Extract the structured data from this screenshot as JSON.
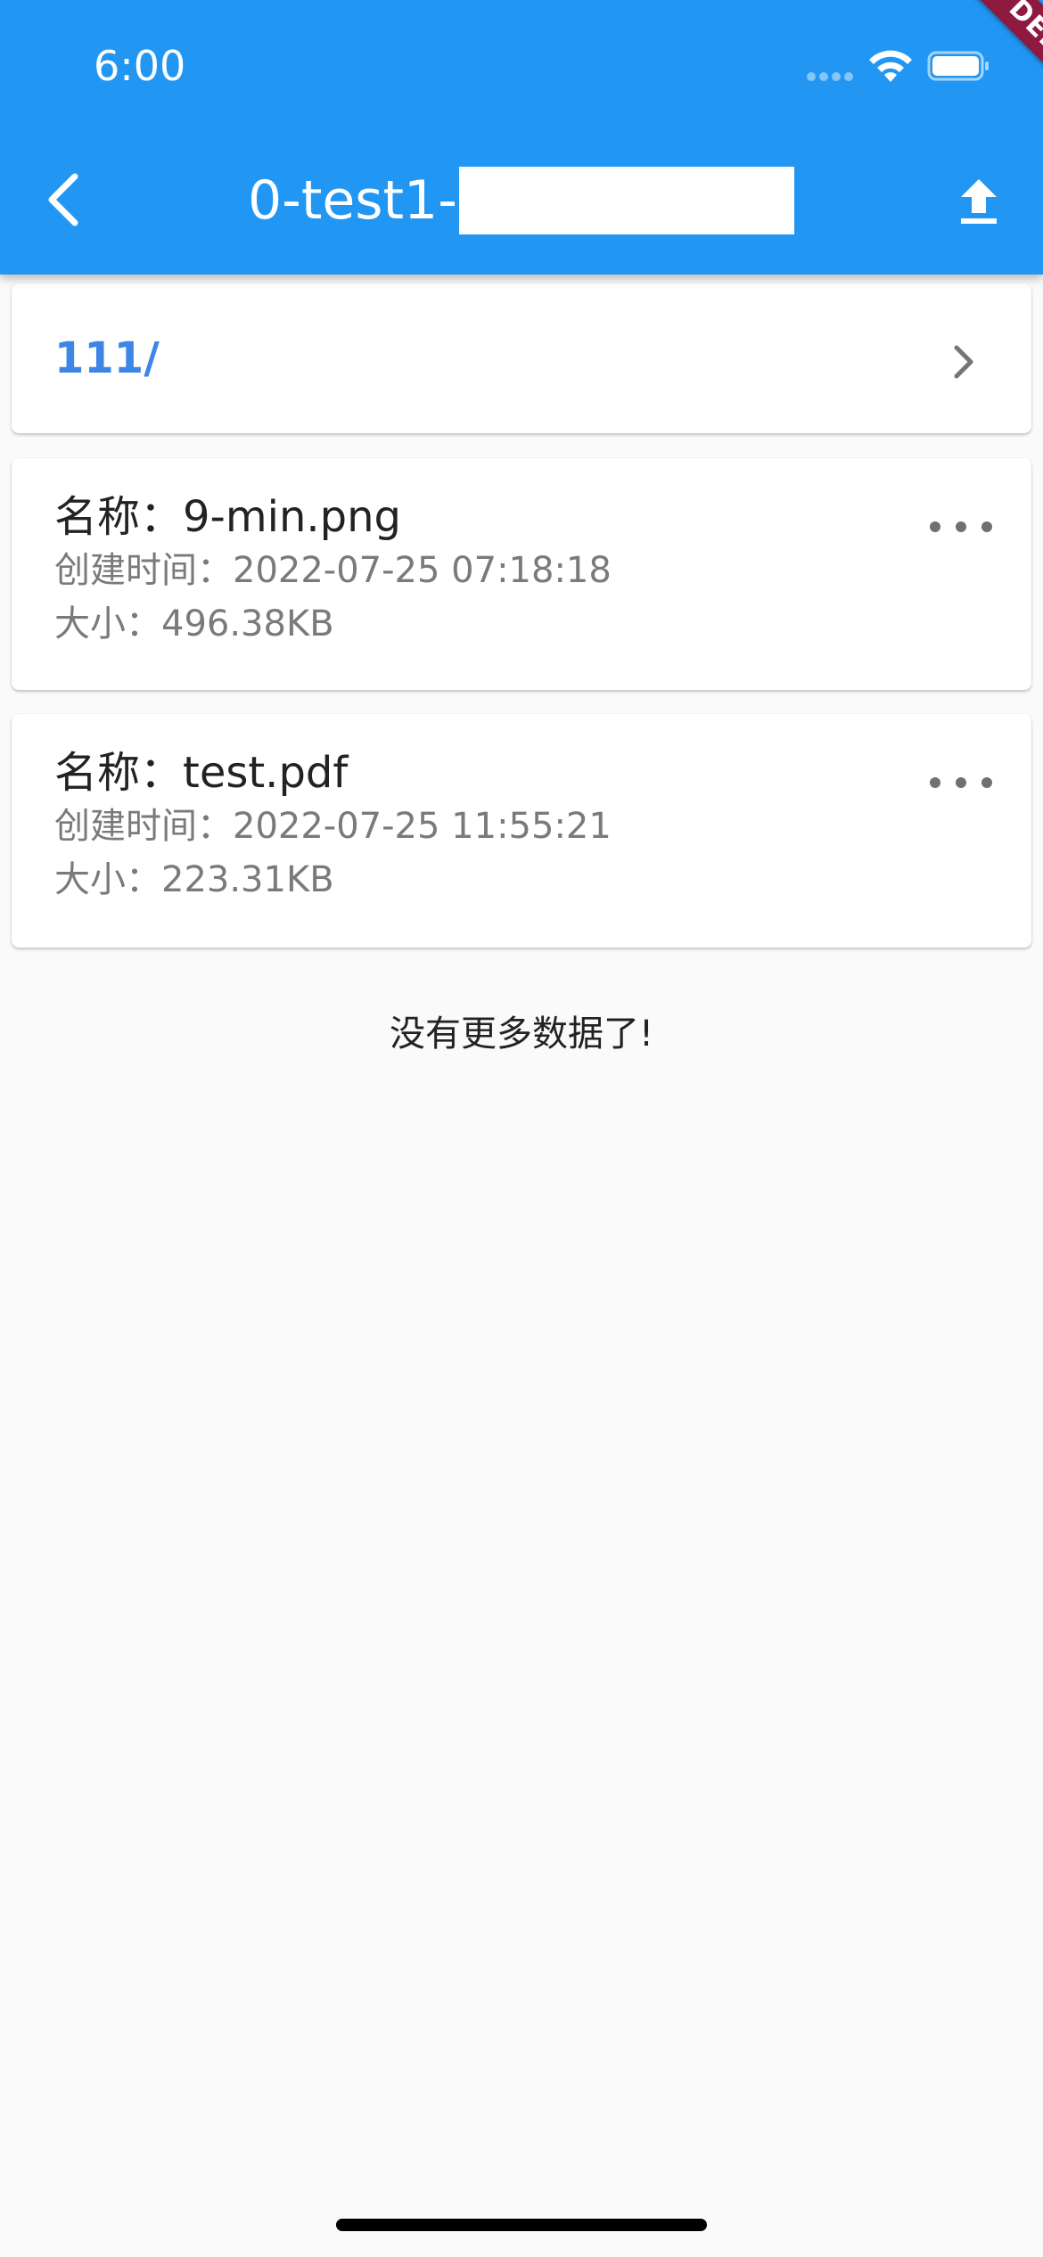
{
  "status_bar": {
    "time": "6:00"
  },
  "debug_banner": "DEBUG",
  "app_bar": {
    "title": "0-test1-",
    "back_icon": "chevron-left-icon",
    "upload_icon": "upload-icon",
    "background_color": "#2196f3"
  },
  "folders": [
    {
      "name": "111/",
      "icon": "chevron-right-icon"
    }
  ],
  "files": [
    {
      "name": "名称：9-min.png",
      "created": "创建时间：2022-07-25 07:18:18",
      "size": "大小：496.38KB"
    },
    {
      "name": "名称：test.pdf",
      "created": "创建时间：2022-07-25 11:55:21",
      "size": "大小：223.31KB"
    }
  ],
  "footer_message": "没有更多数据了!",
  "colors": {
    "accent": "#2196f3",
    "folder_text": "#3d85e6",
    "debug": "#8e1b3f"
  }
}
